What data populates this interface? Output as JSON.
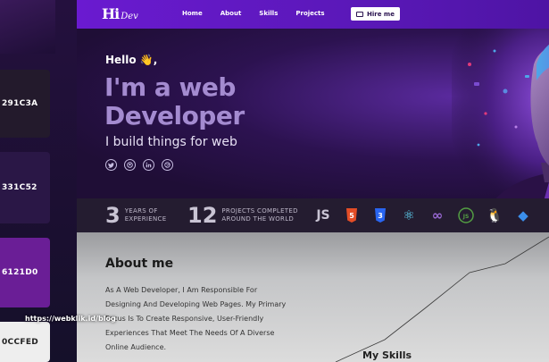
{
  "swatches": [
    "291C3A",
    "331C52",
    "6121D0",
    "0CCFED"
  ],
  "nav": {
    "logo_mark": "Hi",
    "logo_text": "Dev",
    "links": [
      "Home",
      "About",
      "Skills",
      "Projects"
    ],
    "cta": "Hire me"
  },
  "hero": {
    "greeting": "Hello 👋,",
    "headline_line1": "I'm a web",
    "headline_line2": "Developer",
    "tagline": "I build things for web",
    "socials": [
      "twitter-icon",
      "github-icon",
      "linkedin-icon",
      "dribbble-icon"
    ]
  },
  "stats": [
    {
      "number": "3",
      "label_line1": "YEARS OF",
      "label_line2": "EXPERIENCE"
    },
    {
      "number": "12",
      "label_line1": "PROJECTS COMPLETED",
      "label_line2": "AROUND THE WORLD"
    }
  ],
  "techs": [
    {
      "name": "js-icon",
      "text": "JS",
      "color": "#c9c4d4"
    },
    {
      "name": "html5-icon",
      "text": "5",
      "color": "#e44d26"
    },
    {
      "name": "css3-icon",
      "text": "3",
      "color": "#2965f1"
    },
    {
      "name": "react-icon",
      "text": "⚛",
      "color": "#61dafb"
    },
    {
      "name": "redux-icon",
      "text": "∞",
      "color": "#9b6ad6"
    },
    {
      "name": "nodejs-icon",
      "text": "JS",
      "color": "#539e43"
    },
    {
      "name": "linux-icon",
      "text": "🐧",
      "color": "#ffffff"
    },
    {
      "name": "vscode-icon",
      "text": "◆",
      "color": "#3b8eea"
    }
  ],
  "about": {
    "title": "About me",
    "paragraph": "As A Web Developer, I Am Responsible For Designing And Developing Web Pages. My Primary Focus Is To Create Responsive, User-Friendly Experiences That Meet The Needs Of A Diverse Online Audience.",
    "skills_heading": "My Skills"
  },
  "watermark": "https://webklik.id/blog"
}
